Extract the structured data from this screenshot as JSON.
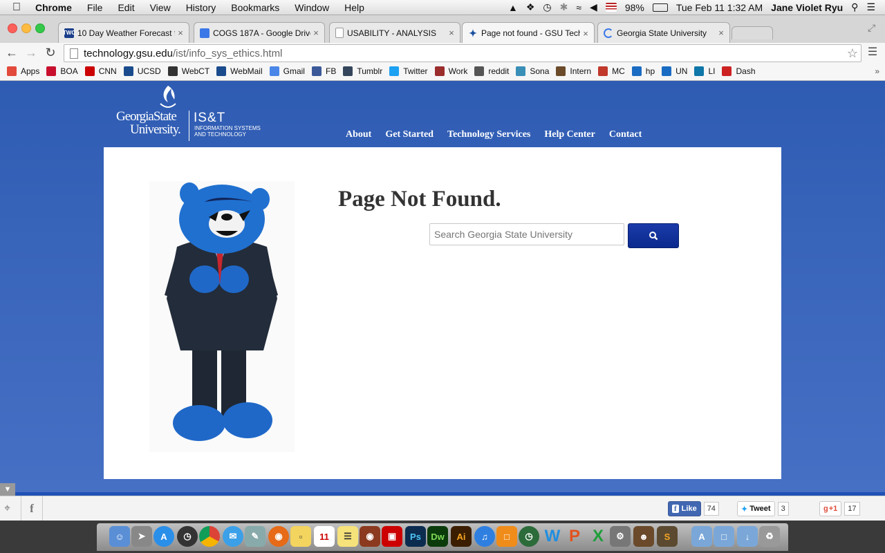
{
  "menubar": {
    "apple": "",
    "items": [
      "Chrome",
      "File",
      "Edit",
      "View",
      "History",
      "Bookmarks",
      "Window",
      "Help"
    ],
    "battery": "98%",
    "datetime": "Tue Feb 11  1:32 AM",
    "user": "Jane Violet Ryu"
  },
  "tabs": [
    {
      "title": "10 Day Weather Forecast f",
      "fav": "TWC",
      "color": "#1b3e8a"
    },
    {
      "title": "COGS 187A - Google Drive",
      "fav": "",
      "color": "#3b78e7"
    },
    {
      "title": "USABILITY - ANALYSIS",
      "fav": "",
      "color": "#ffffff"
    },
    {
      "title": "Page not found - GSU Tech",
      "fav": "",
      "color": "#ffffff"
    },
    {
      "title": "Georgia State University",
      "fav": "",
      "color": "#ffffff"
    }
  ],
  "address": {
    "host": "technology.gsu.edu",
    "path": "/ist/info_sys_ethics.html"
  },
  "bookmarks": [
    {
      "label": "Apps",
      "color": "#e24a3b"
    },
    {
      "label": "BOA",
      "color": "#c8102e"
    },
    {
      "label": "CNN",
      "color": "#cc0000"
    },
    {
      "label": "UCSD",
      "color": "#1a4b8c"
    },
    {
      "label": "WebCT",
      "color": "#333333"
    },
    {
      "label": "WebMail",
      "color": "#1a4b8c"
    },
    {
      "label": "Gmail",
      "color": "#4a86e8"
    },
    {
      "label": "FB",
      "color": "#3b5998"
    },
    {
      "label": "Tumblr",
      "color": "#35465c"
    },
    {
      "label": "Twitter",
      "color": "#1da1f2"
    },
    {
      "label": "Work",
      "color": "#9b2d2d"
    },
    {
      "label": "reddit",
      "color": "#555555"
    },
    {
      "label": "Sona",
      "color": "#3a8fb7"
    },
    {
      "label": "Intern",
      "color": "#6b4b2a"
    },
    {
      "label": "MC",
      "color": "#c0392b"
    },
    {
      "label": "hp",
      "color": "#1a6cc2"
    },
    {
      "label": "UN",
      "color": "#1a6cc2"
    },
    {
      "label": "LI",
      "color": "#0e76a8"
    },
    {
      "label": "Dash",
      "color": "#cc2222"
    }
  ],
  "site": {
    "logo_line1": "GeorgiaState",
    "logo_line2": "University.",
    "dept": "IS&T",
    "dept_sub1": "INFORMATION SYSTEMS",
    "dept_sub2": "AND TECHNOLOGY",
    "nav": [
      "About",
      "Get Started",
      "Technology Services",
      "Help Center",
      "Contact"
    ],
    "heading": "Page Not Found.",
    "search_placeholder": "Search Georgia State University"
  },
  "social": {
    "like_label": "Like",
    "like_count": "74",
    "tweet_label": "Tweet",
    "tweet_count": "3",
    "gplus_label": "+1",
    "gplus_count": "17"
  },
  "colors": {
    "brand": "#2f5fb8",
    "search_button": "#0b2a8e"
  }
}
